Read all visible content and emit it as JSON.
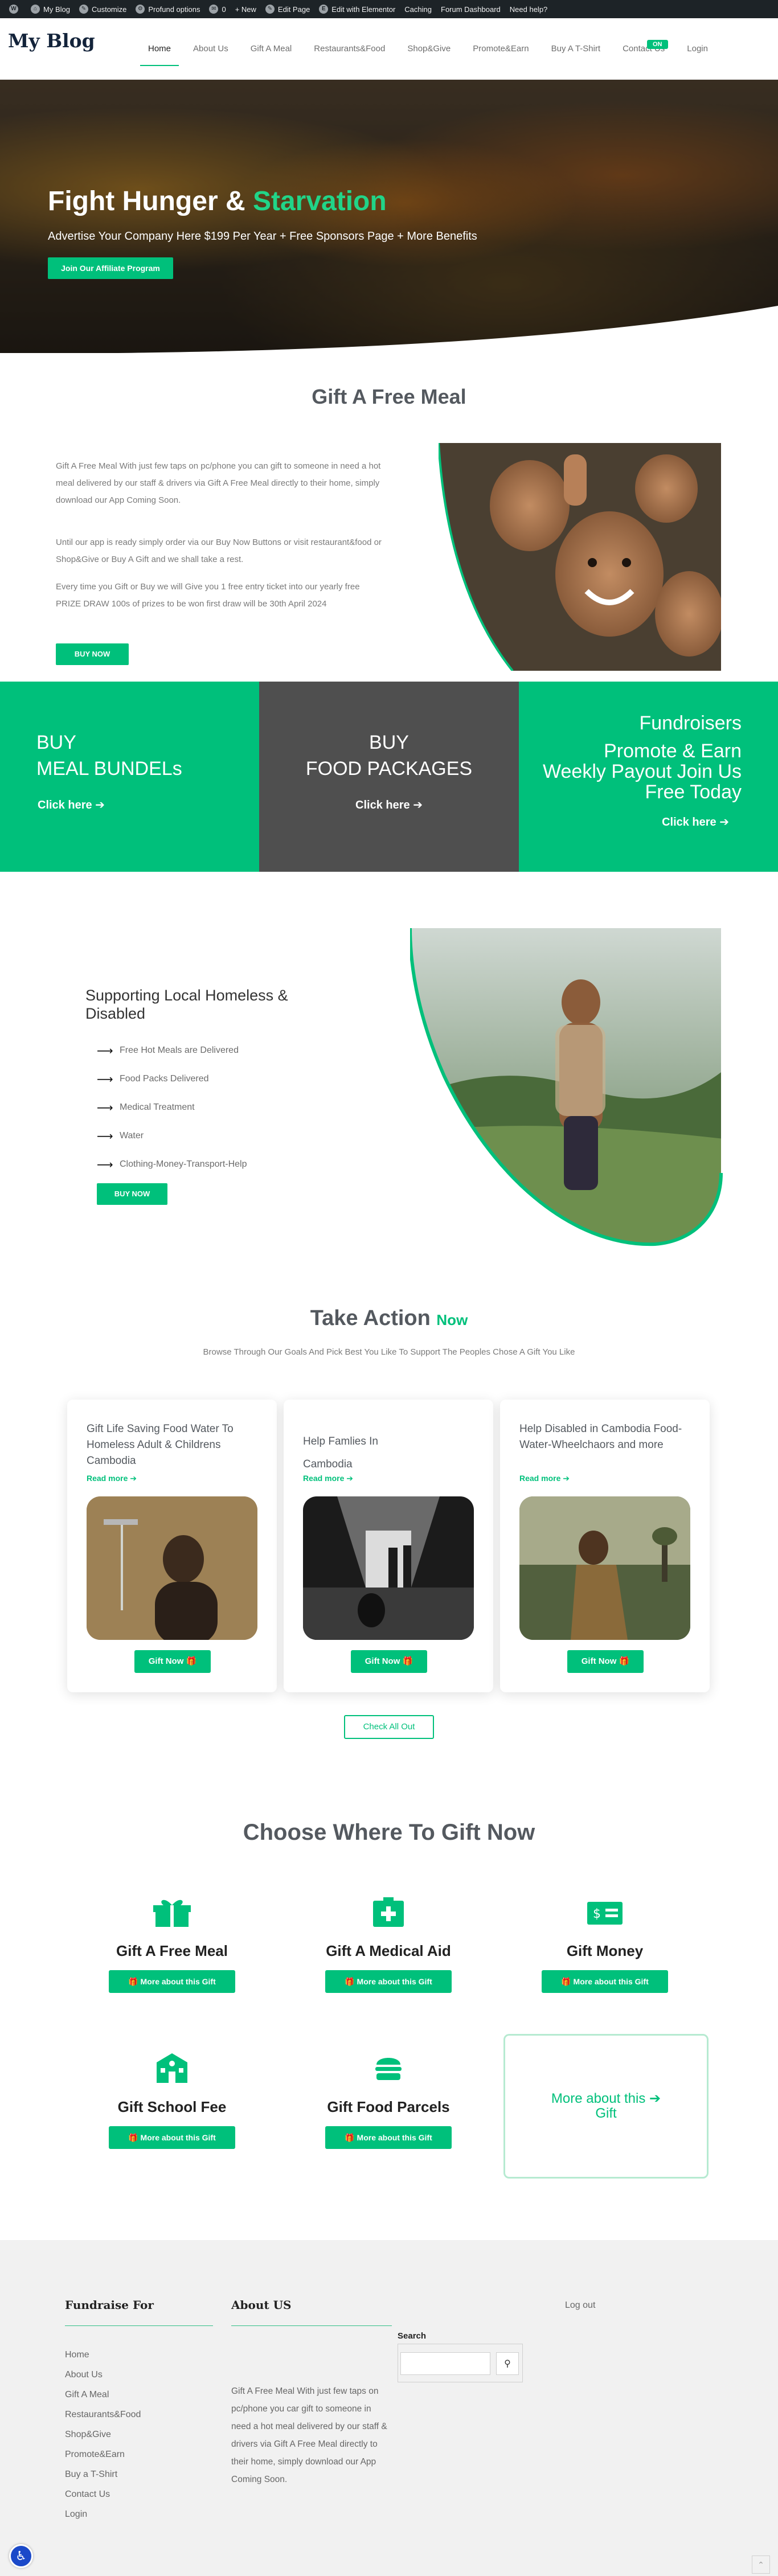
{
  "adminbar": {
    "items": [
      "My Blog",
      "Customize",
      "Profund options",
      "0",
      "+ New",
      "Edit Page",
      "Edit with Elementor",
      "Caching",
      "Forum Dashboard",
      "Need help?"
    ]
  },
  "header": {
    "logo": "My Blog",
    "nav": [
      "Home",
      "About Us",
      "Gift A Meal",
      "Restaurants&Food",
      "Shop&Give",
      "Promote&Earn",
      "Buy A T-Shirt",
      "Contact Us",
      "Login"
    ],
    "badge": "ON"
  },
  "hero": {
    "title_a": "Fight Hunger & ",
    "title_b": "Starvation",
    "subtitle": "Advertise Your Company Here $199 Per Year + Free Sponsors Page + More Benefits",
    "button": "Join Our Affiliate Program"
  },
  "meal": {
    "title": "Gift A Free Meal",
    "p1": "Gift A Free Meal With just few taps on pc/phone you can gift to someone in need a hot meal delivered by our staff & drivers via Gift A Free Meal directly to their home, simply download our App Coming Soon.",
    "p2": "Until our app is ready simply order via our Buy Now Buttons or visit restaurant&food or Shop&Give or Buy A Gift and we shall take a rest.",
    "p3": "Every time you Gift or Buy we will Give you 1 free entry ticket into  our yearly free PRIZE DRAW 100s of prizes to be won first draw will be 30th April 2024",
    "button": "BUY NOW"
  },
  "boxes": {
    "b1_line1": "BUY",
    "b1_line2": "MEAL BUNDELs",
    "b1_link": "Click here",
    "b2_line1": "BUY",
    "b2_line2": "FOOD PACKAGES",
    "b2_link": "Click here",
    "b3_line1": "Fundroisers",
    "b3_line2": "Promote & Earn",
    "b3_line3": "Weekly Payout Join Us",
    "b3_line4": "Free Today",
    "b3_link": "Click here"
  },
  "homeless": {
    "title_1": "Supporting Local Homeless &",
    "title_2": "Disabled",
    "items": [
      "Free Hot Meals are Delivered",
      "Food Packs Delivered",
      "Medical Treatment",
      "Water",
      "Clothing-Money-Transport-Help"
    ],
    "button": "BUY NOW"
  },
  "action": {
    "title": "Take Action ",
    "title_accent": "Now",
    "subtitle": "Browse Through Our Goals And Pick Best You Like To Support The Peoples Chose A Gift You Like",
    "cards": [
      {
        "title": "Gift Life Saving Food Water To Homeless Adult & Childrens Cambodia",
        "read_more": "Read more",
        "button": "Gift Now"
      },
      {
        "title": "Help Famlies In Cambodia",
        "read_more": "Read more",
        "button": "Gift Now"
      },
      {
        "title": "Help Disabled in Cambodia Food-Water-Wheelchaors and more",
        "read_more": "Read more",
        "button": "Gift Now"
      }
    ],
    "check_all": "Check All Out"
  },
  "choose": {
    "title": "Choose Where To Gift Now",
    "options": [
      {
        "name": "Gift A Free Meal",
        "icon": "gift-box-icon",
        "button": "More about this Gift"
      },
      {
        "name": "Gift A Medical Aid",
        "icon": "medical-kit-icon",
        "button": "More about this Gift"
      },
      {
        "name": "Gift Money",
        "icon": "money-icon",
        "button": "More about this Gift"
      },
      {
        "name": "Gift School Fee",
        "icon": "school-icon",
        "button": "More about this Gift"
      },
      {
        "name": "Gift Food Parcels",
        "icon": "burger-icon",
        "button": "More about this Gift"
      }
    ],
    "more_box_1": "More about this",
    "more_box_2": "Gift"
  },
  "footer": {
    "col1_title": "Fundraise For",
    "links": [
      "Home",
      "About Us",
      "Gift A Meal",
      "Restaurants&Food",
      "Shop&Give",
      "Promote&Earn",
      "Buy a T-Shirt",
      "Contact Us",
      "Login"
    ],
    "col2_title": "About US",
    "about_text": "Gift A Free Meal With just few taps on pc/phone you car gift to someone in need a hot meal delivered by our staff & drivers via Gift A Free Meal directly to their home, simply download our App Coming Soon.",
    "search_label": "Search",
    "logout": "Log out"
  },
  "colors": {
    "accent": "#00c07b",
    "dark_box": "#4f4f4f",
    "admin_bar": "#1d2327"
  }
}
